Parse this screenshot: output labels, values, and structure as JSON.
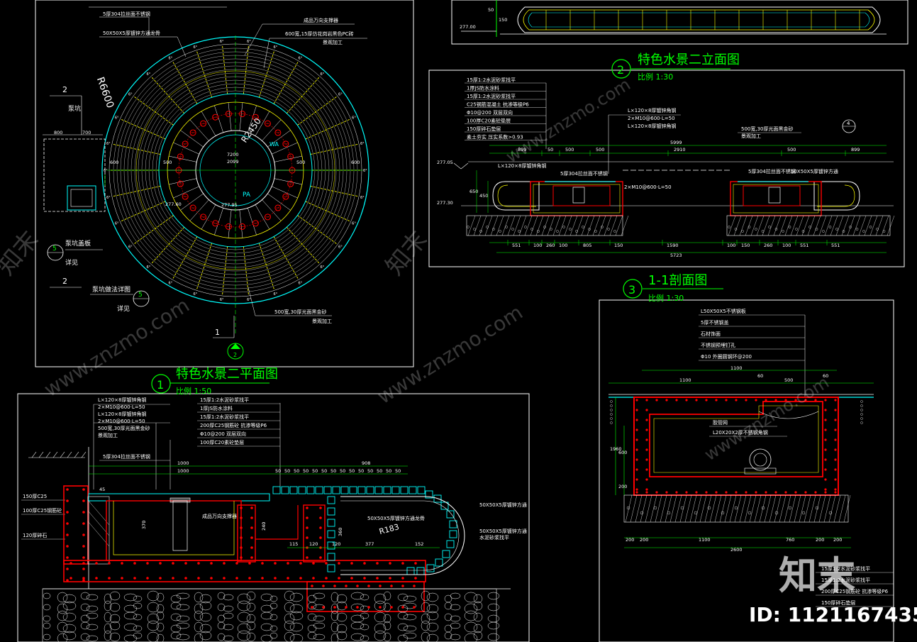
{
  "titles": {
    "plan": "特色水景二平面图",
    "plan_num": "1",
    "plan_scale": "比例 1:50",
    "elev": "特色水景二立面图",
    "elev_num": "2",
    "elev_scale": "比例 1:30",
    "sect": "1-1剖面图",
    "sect_num": "3",
    "sect_scale": "比例 1:30"
  },
  "plan_labels": {
    "pump_pit": "泵坑",
    "pump_cover": "泵坑盖板",
    "see_detail": "详见",
    "pump_detail": "泵坑做法详图",
    "see": "详见",
    "ref5": "5",
    "ref2": "2",
    "ref2b": "2",
    "ref1": "1",
    "r6600": "R6600",
    "r2450": "R2450",
    "pa": "PA",
    "wa": "WA",
    "dim7200": "7200",
    "dim2099": "2099",
    "el27795": "277.95",
    "el27760": "277.60",
    "d800": "800",
    "d700": "700",
    "d600": "600",
    "d500": "500"
  },
  "plan_notes": [
    "5厚304拉丝面不锈钢",
    "50X50X5厚镀锌方通龙骨",
    "成品万向支撑器",
    "600宽,15厚仿花岗岩黑色PC砖",
    "景观加工",
    "500宽,30厚光面黑金砂",
    "景观加工"
  ],
  "elev_notes": [
    "15厚1:2水泥砂浆找平",
    "1厚JS防水涂料",
    "15厚1:2水泥砂浆找平",
    "C25钢筋混凝土 抗渗等级P6",
    "Φ10@200 双层双向",
    "100厚C20素砼垫层",
    "150厚碎石垫层",
    "素土夯实 压实系数>0.93",
    "L×120×8厚镀锌角钢",
    "2×M10@600·L=50",
    "L×120×8厚镀锌角钢",
    "5厚304拉丝面不锈钢",
    "50X50X5厚镀锌方通",
    "5厚304拉丝面不锈钢",
    "500宽,30厚光面黑金砂",
    "景观加工"
  ],
  "elev_dims": [
    "899",
    "50",
    "500",
    "500",
    "2910",
    "500",
    "899",
    "5999",
    "551",
    "100",
    "260",
    "100",
    "805",
    "150",
    "1590",
    "100",
    "150",
    "260",
    "100",
    "551",
    "5723",
    "650",
    "450"
  ],
  "elev_levels": [
    "277.05",
    "277.30"
  ],
  "sect_notes": [
    "L50X50X5不锈钢板",
    "5厚不锈钢盖",
    "石材饰面",
    "不锈钢预埋钉孔",
    "Φ10 外圈圆钢环@200",
    "胶管网",
    "L20X20X2厚不锈钢角钢"
  ],
  "sect_dims": [
    "1100",
    "500",
    "1100",
    "60",
    "60",
    "100",
    "1960",
    "600",
    "200",
    "2600",
    "760",
    "200",
    "200",
    "100",
    "1100"
  ],
  "detail_notes": [
    "L×120×8厚镀锌角钢",
    "2×M10@600·L=50",
    "15厚1:2水泥砂浆找平",
    "1厚JS防水涂料",
    "15厚1:2水泥砂浆找平",
    "200厚C25钢筋砼 抗渗等级P6",
    "Φ10@200 双层双向",
    "100厚C20素砼垫层",
    "L×120×8厚镀锌角钢",
    "2×M10@600·L=50",
    "500宽,30厚光面黑金砂",
    "景观加工",
    "5厚304拉丝面不锈钢",
    "150厚C25",
    "100厚C25钢筋砼",
    "120厚碎石",
    "成品万向支撑器",
    "R183",
    "50X50X5厚镀锌方通龙骨",
    "50X50X5厚镀锌方通",
    "50X50X5厚镀锌方通",
    "水泥砂浆找平"
  ],
  "detail_dims": [
    "1000",
    "1000",
    "50",
    "50",
    "150",
    "50",
    "50",
    "50",
    "50",
    "50",
    "50",
    "50",
    "50",
    "50",
    "50",
    "908",
    "9",
    "45",
    "370",
    "240",
    "360",
    "115",
    "120",
    "120",
    "377",
    "152"
  ],
  "corner_notes": [
    "15厚1:2水泥砂浆找平",
    "15厚1:2水泥砂浆找平",
    "200厚C25钢筋砼 抗渗等级P6",
    "150厚碎石垫层"
  ],
  "elev_top": [
    "277.00",
    "50",
    "150",
    "5"
  ],
  "watermarks": {
    "brand": "知末",
    "site": "www.znzmo.com",
    "id": "ID: 1121167435"
  },
  "colors": {
    "bg": "#000000",
    "frame": "#ffffff",
    "cyan": "#00ffff",
    "green": "#00ff00",
    "red": "#ff0000",
    "yellow": "#ffff00",
    "white": "#ffffff"
  }
}
